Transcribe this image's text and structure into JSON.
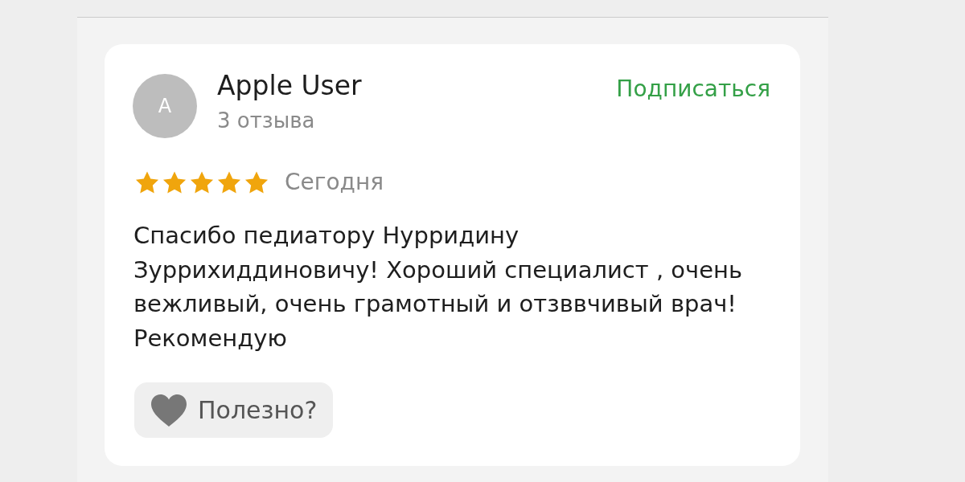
{
  "reviewer": {
    "avatar_letter": "A",
    "name": "Apple User",
    "review_count": "3 отзыва"
  },
  "subscribe_link": "Подписаться",
  "rating": {
    "stars": 5,
    "date": "Сегодня"
  },
  "review_text": "Спасибо педиатору Нурридину Зуррихиддиновичу! Хороший специалист , очень вежливый, очень грамотный и отзввчивый врач! Рекомендую",
  "helpful_button": {
    "label": "Полезно?"
  }
}
